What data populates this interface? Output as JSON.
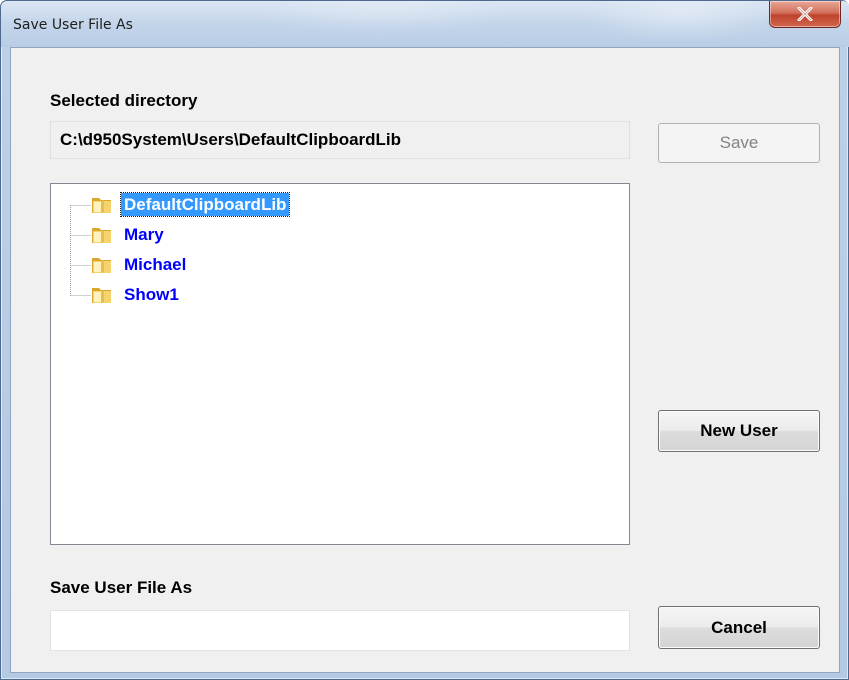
{
  "window": {
    "title": "Save User File As",
    "close_glyph": "x"
  },
  "directory": {
    "label": "Selected directory",
    "path": "C:\\d950System\\Users\\DefaultClipboardLib"
  },
  "tree": {
    "items": [
      {
        "label": "DefaultClipboardLib",
        "icon": "folder-icon",
        "selected": true
      },
      {
        "label": "Mary",
        "icon": "folder-icon",
        "selected": false
      },
      {
        "label": "Michael",
        "icon": "folder-icon",
        "selected": false
      },
      {
        "label": "Show1",
        "icon": "folder-icon",
        "selected": false
      }
    ]
  },
  "filename": {
    "label": "Save User File As",
    "value": ""
  },
  "buttons": {
    "save": "Save",
    "new_user": "New User",
    "cancel": "Cancel"
  },
  "colors": {
    "link_blue": "#0000ff",
    "selection": "#3399ff",
    "close_red": "#c0432c"
  }
}
